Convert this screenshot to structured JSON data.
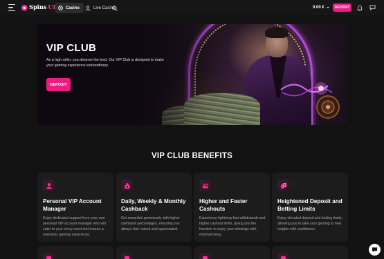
{
  "header": {
    "logo": {
      "part1": "Spins",
      "part2": "UP"
    },
    "nav": [
      {
        "label": "Casino",
        "icon": "casino-chip-icon",
        "active": true
      },
      {
        "label": "Live Casino",
        "icon": "live-dealer-icon",
        "active": false
      }
    ],
    "balance": "0.00 €",
    "deposit_label": "DEPOSIT"
  },
  "hero": {
    "title": "VIP CLUB",
    "text": "As a high roller, you deserve the best. Our VIP Club is designed to make your gaming experience extraordinary.",
    "deposit_label": "DEPOSIT"
  },
  "benefits": {
    "title": "VIP CLUB BENEFITS",
    "cards": [
      {
        "title": "Personal VIP Account Manager",
        "text": "Enjoy dedicated support from your own personal VIP account manager who will cater to your every need and ensure a seamless gaming experience.",
        "icon": "account-manager-icon"
      },
      {
        "title": "Daily, Weekly & Monthly Cashback",
        "text": "Get rewarded generously with higher cashback percentages, ensuring you always feel valued and appreciated.",
        "icon": "money-bag-icon"
      },
      {
        "title": "Higher and Faster Cashouts",
        "text": "Experience lightning-fast withdrawals and higher cashout limits, giving you the freedom to enjoy your winnings with minimal delay.",
        "icon": "cashout-icon"
      },
      {
        "title": "Heightened Deposit and Betting Limits",
        "text": "Enjoy elevated deposit and betting limits, allowing you to take your gaming to new heights with confidence.",
        "icon": "betting-limits-icon"
      }
    ]
  },
  "colors": {
    "accent": "#e91e82",
    "background": "#121212",
    "card": "#1c1c1c"
  }
}
